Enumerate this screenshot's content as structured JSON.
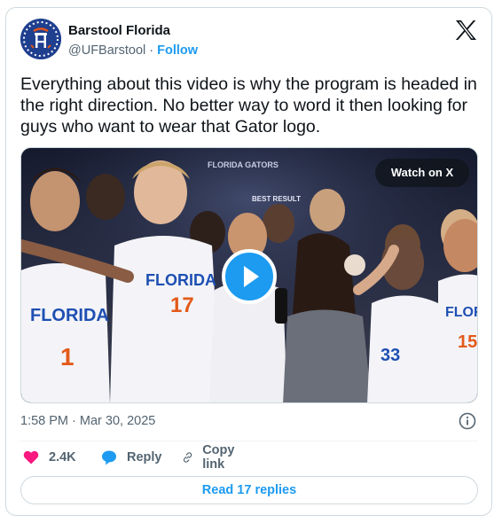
{
  "author": {
    "name": "Barstool Florida",
    "handle": "@UFBarstool",
    "separator": "·",
    "follow_label": "Follow"
  },
  "tweet": {
    "text": "Everything about this video is why the program is headed in the right direction. No better way to word it then looking for guys who want to wear that Gator logo."
  },
  "media": {
    "watch_label": "Watch on X",
    "scene_texts": {
      "banner": "FLORIDA GATORS",
      "board": "BEST RESULT",
      "jersey_left": "FLORIDA",
      "jersey_left_number": "1",
      "jersey_center": "FLORIDA",
      "jersey_center_number": "17",
      "jersey_right_number": "33",
      "jersey_far_right": "FLORIDA",
      "jersey_far_right_number": "15"
    },
    "icons": {
      "play": "play-icon"
    }
  },
  "meta": {
    "time": "1:58 PM",
    "separator": "·",
    "date": "Mar 30, 2025"
  },
  "actions": {
    "likes": "2.4K",
    "reply_label": "Reply",
    "copy_label": "Copy link"
  },
  "replies_button_label": "Read 17 replies",
  "colors": {
    "accent": "#1d9bf0",
    "like": "#f91880",
    "brand_avatar": "#1f3f8f",
    "jersey_text": "#1e4fb3"
  }
}
